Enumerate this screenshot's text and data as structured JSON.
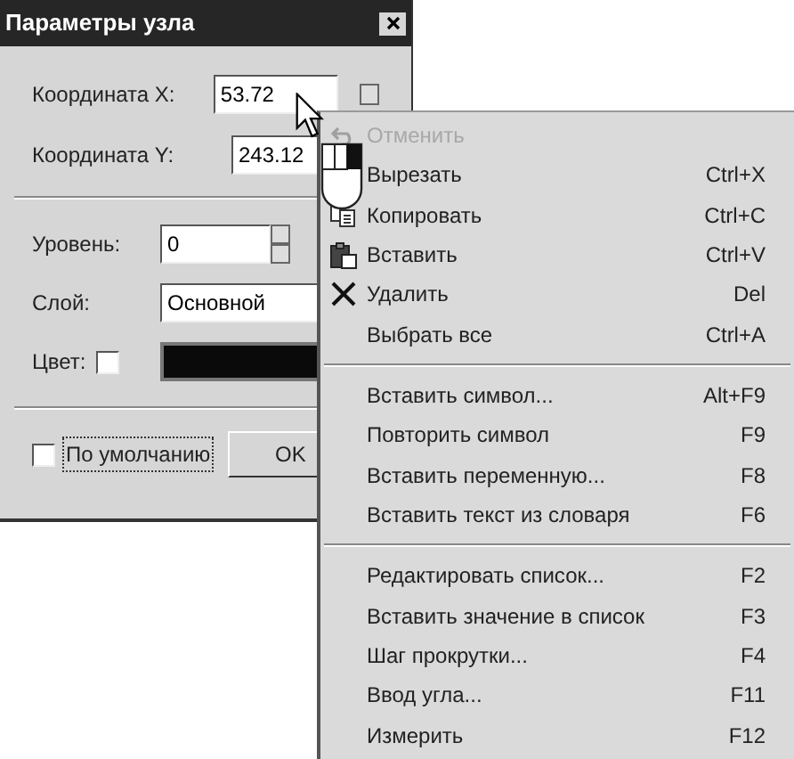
{
  "dialog": {
    "title": "Параметры узла",
    "coord_x": {
      "label": "Координата X:",
      "value": "53.72"
    },
    "coord_y": {
      "label": "Координата Y:",
      "value": "243.12"
    },
    "level": {
      "label": "Уровень:",
      "value": "0"
    },
    "layer": {
      "label": "Слой:",
      "value": "Основной"
    },
    "color": {
      "label": "Цвет:",
      "checked": false,
      "color": "#0a0a0a"
    },
    "default": {
      "label": "По умолчанию",
      "checked": false
    },
    "ok_button": "OK"
  },
  "context_menu": {
    "items": [
      {
        "kind": "item",
        "label": "Отменить",
        "disabled": true
      },
      {
        "kind": "item",
        "label": "Вырезать",
        "shortcut": "Ctrl+X",
        "disabled": false
      },
      {
        "kind": "item",
        "label": "Копировать",
        "shortcut": "Ctrl+C",
        "disabled": false
      },
      {
        "kind": "item",
        "label": "Вставить",
        "shortcut": "Ctrl+V",
        "disabled": false
      },
      {
        "kind": "item",
        "label": "Удалить",
        "shortcut": "Del",
        "disabled": false
      },
      {
        "kind": "item",
        "label": "Выбрать все",
        "shortcut": "Ctrl+A",
        "disabled": false
      },
      {
        "kind": "separator"
      },
      {
        "kind": "item",
        "label": "Вставить символ...",
        "shortcut": "Alt+F9",
        "disabled": false
      },
      {
        "kind": "item",
        "label": "Повторить символ",
        "shortcut": "F9",
        "disabled": false
      },
      {
        "kind": "item",
        "label": "Вставить переменную...",
        "shortcut": "F8",
        "disabled": false
      },
      {
        "kind": "item",
        "label": "Вставить текст из словаря",
        "shortcut": "F6",
        "disabled": false
      },
      {
        "kind": "separator"
      },
      {
        "kind": "item",
        "label": "Редактировать список...",
        "shortcut": "F2",
        "disabled": false
      },
      {
        "kind": "item",
        "label": "Вставить значение в список",
        "shortcut": "F3",
        "disabled": false
      },
      {
        "kind": "item",
        "label": "Шаг прокрутки...",
        "shortcut": "F4",
        "disabled": false
      },
      {
        "kind": "item",
        "label": "Ввод угла...",
        "shortcut": "F11",
        "disabled": false
      },
      {
        "kind": "item",
        "label": "Измерить",
        "shortcut": "F12",
        "disabled": false
      }
    ]
  }
}
